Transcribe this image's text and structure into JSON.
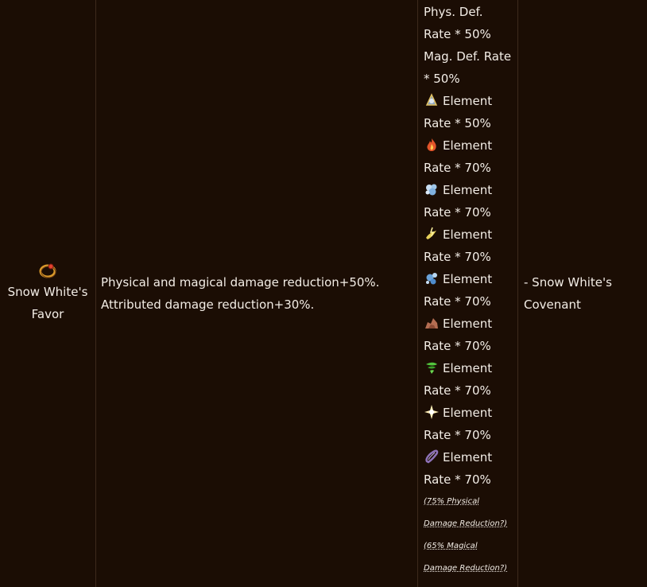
{
  "row": {
    "name_lines": [
      "Snow White's",
      "Favor"
    ],
    "description_lines": [
      "Physical and magical damage reduction+50%.",
      "Attributed damage reduction+30%."
    ],
    "stat_lines": [
      "Phys. Def.",
      "Rate * 50%",
      "Mag. Def. Rate",
      "* 50%"
    ],
    "elements": [
      {
        "icon": "neutral-element-icon",
        "label": "Element",
        "rate": "Rate * 50%",
        "color": "#9ab0c8"
      },
      {
        "icon": "fire-element-icon",
        "label": "Element",
        "rate": "Rate * 70%",
        "color": "#e2542a"
      },
      {
        "icon": "water-element-icon",
        "label": "Element",
        "rate": "Rate * 70%",
        "color": "#9fc6e8"
      },
      {
        "icon": "wind-element-icon",
        "label": "Element",
        "rate": "Rate * 70%",
        "color": "#e8d15a"
      },
      {
        "icon": "ice-element-icon",
        "label": "Element",
        "rate": "Rate * 70%",
        "color": "#6aa2d8"
      },
      {
        "icon": "earth-element-icon",
        "label": "Element",
        "rate": "Rate * 70%",
        "color": "#b46d52"
      },
      {
        "icon": "poison-element-icon",
        "label": "Element",
        "rate": "Rate * 70%",
        "color": "#52c43d"
      },
      {
        "icon": "holy-element-icon",
        "label": "Element",
        "rate": "Rate * 70%",
        "color": "#fff0b8"
      },
      {
        "icon": "dark-element-icon",
        "label": "Element",
        "rate": "Rate * 70%",
        "color": "#8e72b8"
      }
    ],
    "notes": [
      "(75% Physical",
      "Damage Reduction?)",
      "(65% Magical",
      "Damage Reduction?)"
    ],
    "source": [
      "- Snow White's",
      "Covenant"
    ]
  }
}
